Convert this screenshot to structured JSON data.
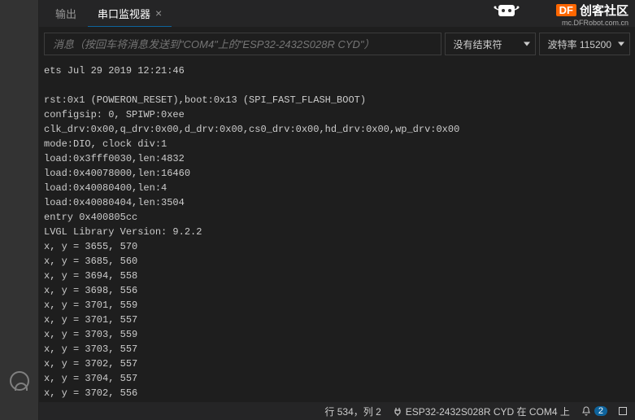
{
  "tabs": {
    "output": "输出",
    "serial_monitor": "串口监视器"
  },
  "logo": {
    "df": "DF",
    "title": "创客社区",
    "sub": "mc.DFRobot.com.cn"
  },
  "input": {
    "placeholder": "消息（按回车将消息发送到\"COM4\"上的\"ESP32-2432S028R CYD\"）"
  },
  "dropdowns": {
    "line_ending": "没有结束符",
    "baud_label": "波特率 115200"
  },
  "terminal_lines": [
    "ets Jul 29 2019 12:21:46",
    "",
    "rst:0x1 (POWERON_RESET),boot:0x13 (SPI_FAST_FLASH_BOOT)",
    "configsip: 0, SPIWP:0xee",
    "clk_drv:0x00,q_drv:0x00,d_drv:0x00,cs0_drv:0x00,hd_drv:0x00,wp_drv:0x00",
    "mode:DIO, clock div:1",
    "load:0x3fff0030,len:4832",
    "load:0x40078000,len:16460",
    "load:0x40080400,len:4",
    "load:0x40080404,len:3504",
    "entry 0x400805cc",
    "LVGL Library Version: 9.2.2",
    "x, y = 3655, 570",
    "x, y = 3685, 560",
    "x, y = 3694, 558",
    "x, y = 3698, 556",
    "x, y = 3701, 559",
    "x, y = 3701, 557",
    "x, y = 3703, 559",
    "x, y = 3703, 557",
    "x, y = 3702, 557",
    "x, y = 3704, 557",
    "x, y = 3702, 556"
  ],
  "status": {
    "position": "行 534，列 2",
    "board": "ESP32-2432S028R CYD 在 COM4 上",
    "notif_count": "2"
  }
}
